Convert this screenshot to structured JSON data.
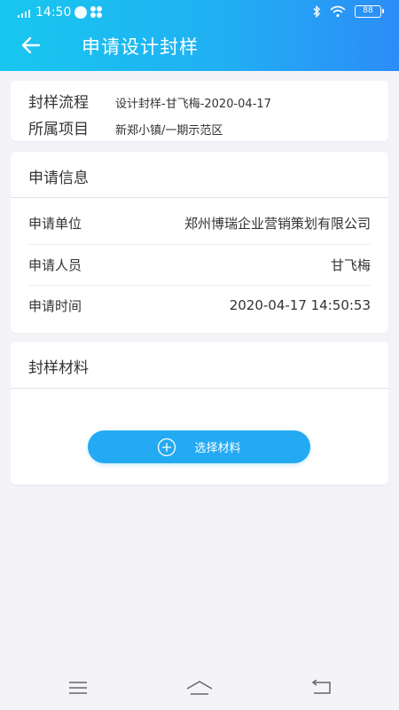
{
  "status": {
    "time": "14:50",
    "battery": "88"
  },
  "header": {
    "title": "申请设计封样",
    "back_icon": "arrow-left-icon"
  },
  "flow": {
    "process_label": "封样流程",
    "process_value": "设计封样-甘飞梅-2020-04-17",
    "project_label": "所属项目",
    "project_value": "新郑小镇/一期示范区"
  },
  "info": {
    "title": "申请信息",
    "rows": [
      {
        "label": "申请单位",
        "value": "郑州博瑞企业营销策划有限公司"
      },
      {
        "label": "申请人员",
        "value": "甘飞梅"
      },
      {
        "label": "申请时间",
        "value": "2020-04-17 14:50:53"
      }
    ]
  },
  "material": {
    "title": "封样材料",
    "select_label": "选择材料",
    "select_icon": "plus-circle-icon"
  },
  "navbar": {
    "menu_icon": "menu-icon",
    "home_icon": "home-icon",
    "back_icon": "return-icon"
  },
  "colors": {
    "header_start": "#18c7ef",
    "header_end": "#2d8cf7",
    "button": "#23aaf2",
    "background": "#f3f3f8"
  }
}
